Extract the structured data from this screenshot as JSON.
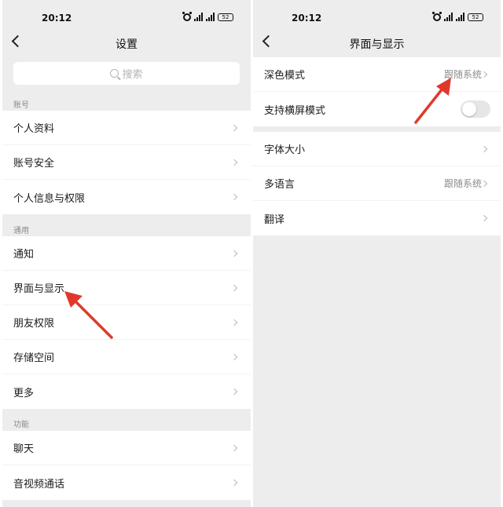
{
  "left": {
    "status": {
      "time": "20:12",
      "battery": "52"
    },
    "nav_title": "设置",
    "search_placeholder": "搜索",
    "sections": [
      {
        "header": "账号",
        "items": [
          "个人资料",
          "账号安全",
          "个人信息与权限"
        ]
      },
      {
        "header": "通用",
        "items": [
          "通知",
          "界面与显示",
          "朋友权限",
          "存储空间",
          "更多"
        ]
      },
      {
        "header": "功能",
        "items": [
          "聊天",
          "音视频通话"
        ]
      }
    ]
  },
  "right": {
    "status": {
      "time": "20:12",
      "battery": "52"
    },
    "nav_title": "界面与显示",
    "group1": {
      "dark_mode": {
        "label": "深色模式",
        "value": "跟随系统"
      },
      "landscape": {
        "label": "支持横屏模式",
        "enabled": false
      }
    },
    "group2": {
      "font_size": {
        "label": "字体大小"
      },
      "language": {
        "label": "多语言",
        "value": "跟随系统"
      },
      "translate": {
        "label": "翻译"
      }
    }
  },
  "icons": [
    "alarm-icon",
    "signal-icon",
    "battery-icon",
    "back-icon",
    "search-icon",
    "chevron-right-icon",
    "toggle-switch"
  ],
  "colors": {
    "background": "#ededed",
    "row": "#ffffff",
    "annotation_arrow": "#e0392b",
    "secondary_text": "#8c8c8c"
  }
}
